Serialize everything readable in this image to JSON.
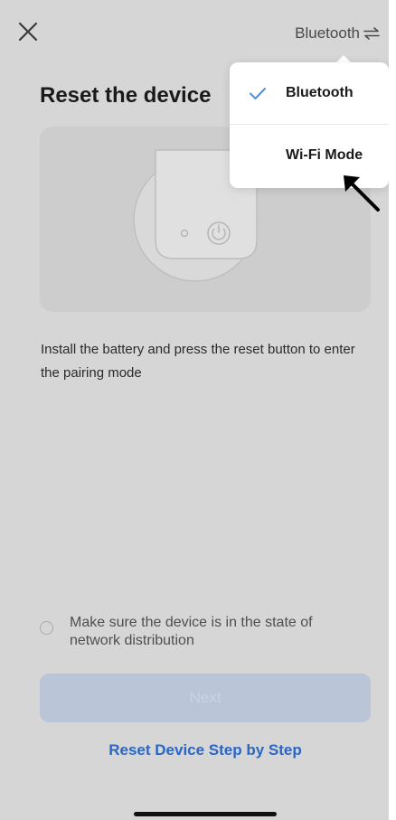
{
  "header": {
    "close_icon": "close-icon",
    "mode_label": "Bluetooth",
    "mode_icon": "swap-arrows-icon"
  },
  "page": {
    "title": "Reset the device",
    "illustration_icon": "device-power-button-illustration",
    "instruction": "Install the battery and press the reset button to enter the pairing mode",
    "confirm_text": "Make sure the device is in the state of network distribution",
    "next_label": "Next",
    "step_link": "Reset Device Step by Step"
  },
  "mode_menu": {
    "items": [
      {
        "label": "Bluetooth",
        "selected": true
      },
      {
        "label": "Wi-Fi Mode",
        "selected": false
      }
    ]
  },
  "colors": {
    "accent": "#2b66c4",
    "check": "#4f8fe6",
    "disabled_button": "#bac6d8",
    "overlay": "#d6d6d6"
  },
  "annotation": {
    "pointer_icon": "pointer-arrow-icon"
  }
}
